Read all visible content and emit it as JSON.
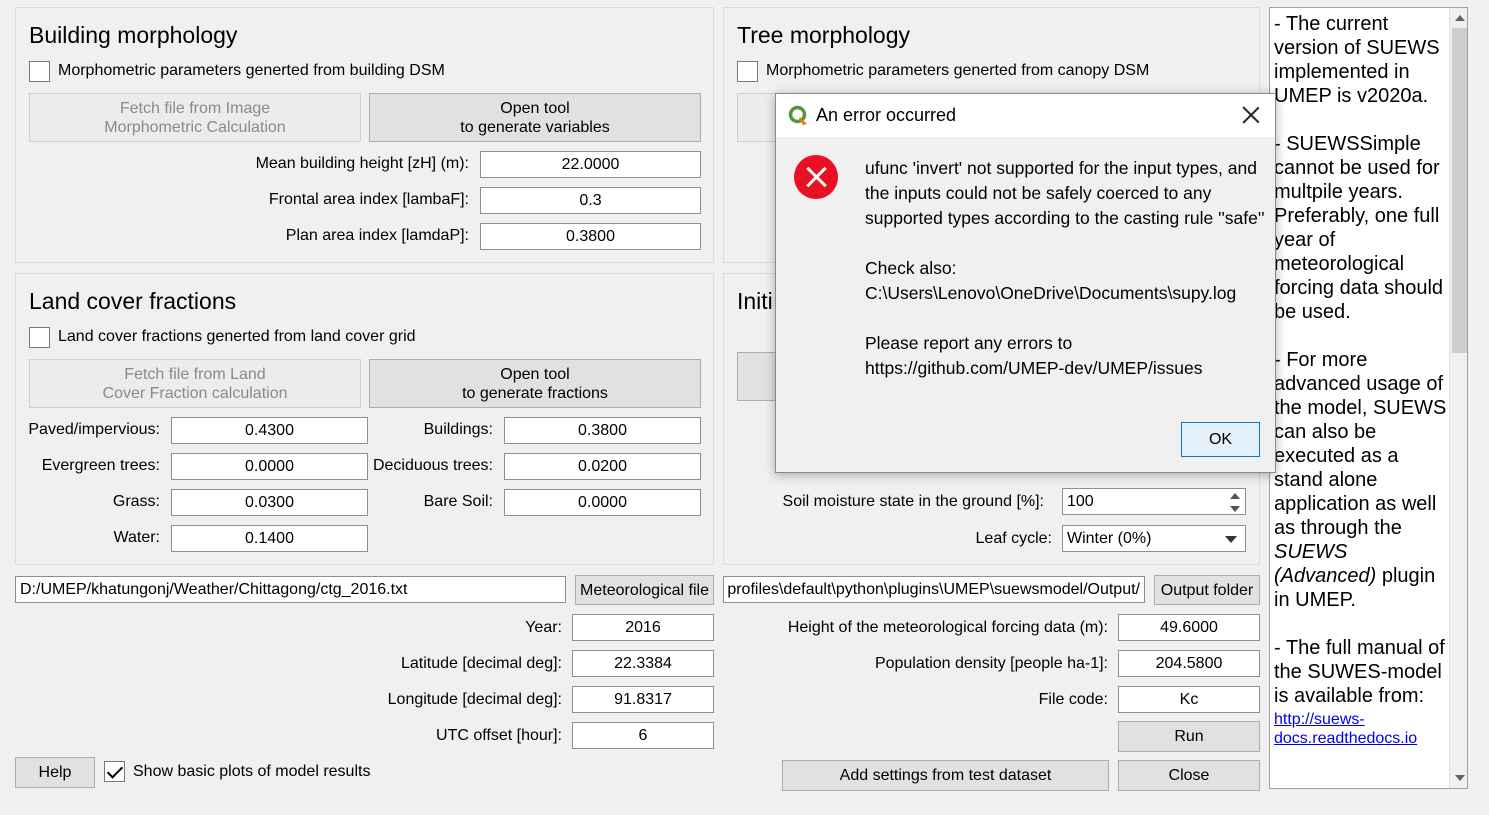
{
  "building": {
    "title": "Building morphology",
    "checkbox_label": "Morphometric parameters generted from building DSM",
    "fetch_button": "Fetch file from Image\nMorphometric Calculation",
    "open_button": "Open tool\nto generate variables",
    "height_label": "Mean building height [zH] (m):",
    "height_value": "22.0000",
    "frontal_label": "Frontal area index [lambaF]:",
    "frontal_value": "0.3",
    "plan_label": "Plan area index [lamdaP]:",
    "plan_value": "0.3800"
  },
  "tree": {
    "title": "Tree morphology",
    "checkbox_label": "Morphometric parameters generted from canopy DSM"
  },
  "landcover": {
    "title": "Land cover fractions",
    "checkbox_label": "Land cover fractions generted from land cover grid",
    "fetch_button": "Fetch file from Land\nCover Fraction calculation",
    "open_button": "Open tool\nto generate fractions",
    "paved_label": "Paved/impervious:",
    "paved_value": "0.4300",
    "buildings_label": "Buildings:",
    "buildings_value": "0.3800",
    "evergreen_label": "Evergreen trees:",
    "evergreen_value": "0.0000",
    "deciduous_label": "Deciduous trees:",
    "deciduous_value": "0.0200",
    "grass_label": "Grass:",
    "grass_value": "0.0300",
    "baresoil_label": "Bare Soil:",
    "baresoil_value": "0.0000",
    "water_label": "Water:",
    "water_value": "0.1400"
  },
  "initial": {
    "title_visible": "Initi",
    "soil_label": "Soil moisture state in the ground [%]:",
    "soil_value": "100",
    "leaf_label": "Leaf cycle:",
    "leaf_value": "Winter (0%)"
  },
  "files": {
    "met_path": "D:/UMEP/khatungonj/Weather/Chittagong/ctg_2016.txt",
    "met_button": "Meteorological file",
    "output_path": "profiles\\default\\python\\plugins\\UMEP\\suewsmodel/Output/",
    "output_button": "Output folder"
  },
  "params": {
    "year_label": "Year:",
    "year_value": "2016",
    "lat_label": "Latitude [decimal deg]:",
    "lat_value": "22.3384",
    "lon_label": "Longitude [decimal deg]:",
    "lon_value": "91.8317",
    "utc_label": "UTC offset [hour]:",
    "utc_value": "6",
    "height_label": "Height of the meteorological forcing data (m):",
    "height_value": "49.6000",
    "pop_label": "Population density [people ha-1]:",
    "pop_value": "204.5800",
    "filecode_label": "File code:",
    "filecode_value": "Kc"
  },
  "bottom": {
    "help_button": "Help",
    "plots_label": "Show basic plots of model results",
    "plots_checked": true,
    "run_button": "Run",
    "test_button": "Add settings from test dataset",
    "close_button": "Close"
  },
  "info": {
    "p1": "- The current version of SUEWS implemented in UMEP is v2020a.",
    "p2": "- SUEWSSimple cannot be used for multpile years. Preferably, one full year of meteorological forcing data should be used.",
    "p3a": "- For more advanced usage of the model, SUEWS can also be executed as a stand alone application as well as through the ",
    "p3b": "SUEWS (Advanced)",
    "p3c": " plugin in UMEP.",
    "p4": "- The full manual of the SUWES-model is available from:",
    "link": "http://suews-docs.readthedocs.io"
  },
  "dialog": {
    "title": "An error occurred",
    "message": "ufunc 'invert' not supported for the input types, and the inputs could not be safely coerced to any supported types according to the casting rule ''safe''",
    "check_also": "Check also: C:\\Users\\Lenovo\\OneDrive\\Documents\\supy.log",
    "report": "Please report any errors to https://github.com/UMEP-dev/UMEP/issues",
    "ok_button": "OK"
  },
  "colors": {
    "accent": "#0078d7",
    "error": "#e81123",
    "qgis_green": "#589632"
  }
}
